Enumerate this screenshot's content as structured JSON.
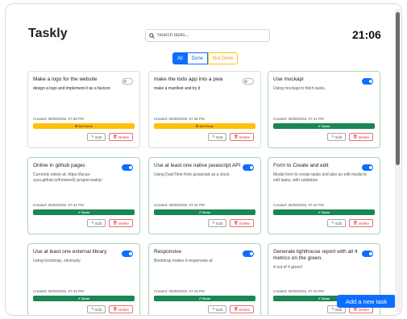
{
  "app": {
    "title": "Taskly",
    "clock": "21:06"
  },
  "search": {
    "placeholder": "Search tasks..."
  },
  "filters": [
    "All",
    "Done",
    "Not Done"
  ],
  "tasks": [
    {
      "title": "Make a logo for the website",
      "description": "design a logo and implement it as a favicon",
      "created": "Created: 05/06/2025, 07:38 PM",
      "status": "Not Done",
      "done": false
    },
    {
      "title": "make the todo app into a pwa",
      "description": "make a manifest and try it",
      "created": "Created: 05/06/2025, 07:38 PM",
      "status": "Not Done",
      "done": false
    },
    {
      "title": "Use mockapi",
      "description": "Using mockapi to fetch tasks.",
      "created": "Created: 05/06/2025, 07:41 PM",
      "status": "Done",
      "done": true
    },
    {
      "title": "Online in github pages",
      "description": "Currently online at: https://lucas-syss.github.io/frontend1-projeto-taskly/",
      "created": "Created: 05/06/2025, 07:41 PM",
      "status": "Done",
      "done": true
    },
    {
      "title": "Use at least one native javascript API",
      "description": "Using DateTime from javascript as a clock.",
      "created": "Created: 05/06/2025, 07:42 PM",
      "status": "Done",
      "done": true
    },
    {
      "title": "Form to Create and edit",
      "description": "Modal form to create tasks and also an edit modal to edit tasks, with validation.",
      "created": "Created: 05/06/2025, 07:42 PM",
      "status": "Done",
      "done": true
    },
    {
      "title": "Use at least one external library",
      "description": "Using bootstrap, obviously.",
      "created": "Created: 05/06/2025, 07:43 PM",
      "status": "Done",
      "done": true
    },
    {
      "title": "Responsive",
      "description": "Bootstrap makes it responsive af.",
      "created": "Created: 05/06/2025, 07:43 PM",
      "status": "Done",
      "done": true
    },
    {
      "title": "Generate lighthouse report with all 4 metrics on the green.",
      "description": "4 out of 4 green!",
      "created": "Created: 05/06/2025, 07:43 PM",
      "status": "Done",
      "done": true
    }
  ],
  "actions": {
    "edit_label": "Edit",
    "delete_label": "Delete"
  },
  "add_button": {
    "label": "Add a new task"
  },
  "colors": {
    "primary": "#0d6efd",
    "done": "#198754",
    "not_done": "#ffc107",
    "delete": "#dc3545"
  }
}
